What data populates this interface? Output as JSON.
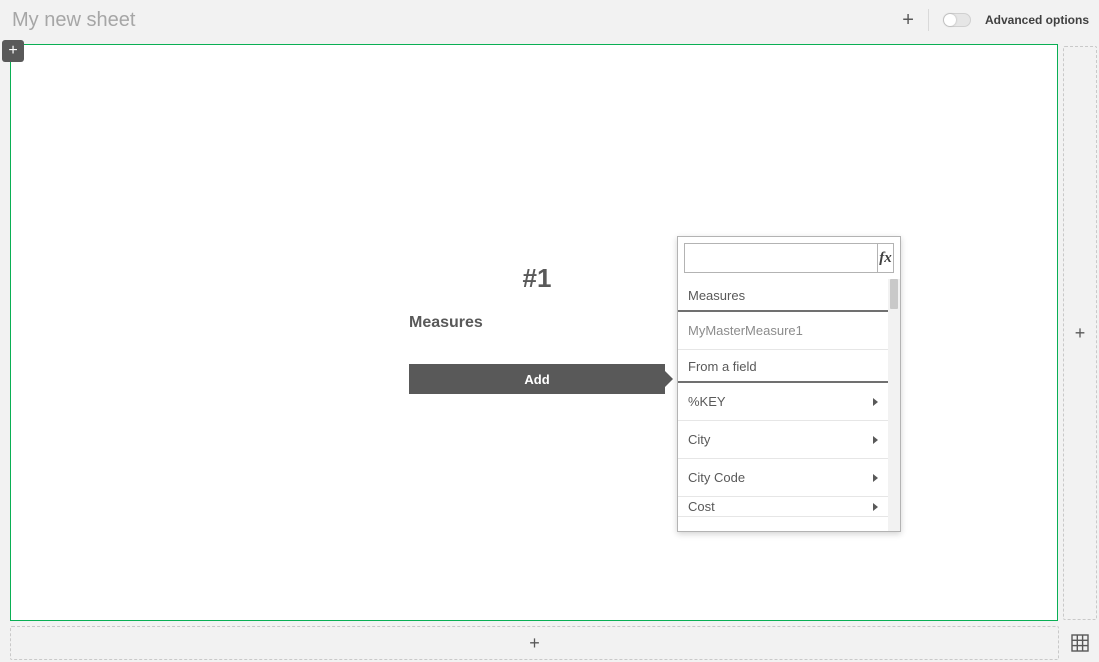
{
  "header": {
    "title": "My new sheet",
    "advanced_label": "Advanced options"
  },
  "center": {
    "number": "#1",
    "heading": "Measures",
    "add_label": "Add"
  },
  "popover": {
    "search_placeholder": "",
    "fx_label": "fx",
    "section_measures": "Measures",
    "measure_items": [
      "MyMasterMeasure1"
    ],
    "section_fields": "From a field",
    "field_items": [
      "%KEY",
      "City",
      "City Code",
      "Cost"
    ]
  },
  "icons": {
    "plus": "+"
  }
}
